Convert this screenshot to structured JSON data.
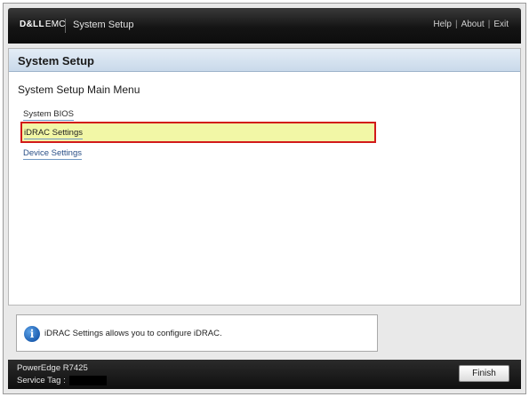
{
  "header": {
    "logo_dell": "D&LL",
    "logo_emc": "EMC",
    "title": "System Setup",
    "links": [
      "Help",
      "About",
      "Exit"
    ],
    "link_separator": "|"
  },
  "panel": {
    "title": "System Setup",
    "menu_heading": "System Setup Main Menu",
    "items": [
      {
        "label": "System BIOS",
        "selected": false
      },
      {
        "label": "iDRAC Settings",
        "selected": true
      },
      {
        "label": "Device Settings",
        "selected": false
      }
    ]
  },
  "info": {
    "icon": "info-icon",
    "glyph": "i",
    "text": "iDRAC Settings allows you to configure iDRAC."
  },
  "footer": {
    "model": "PowerEdge R7425",
    "service_tag_label": "Service Tag :",
    "finish_label": "Finish"
  },
  "colors": {
    "selection_fill": "#f2f7a6",
    "selection_border": "#d21a1a",
    "title_bar": "#c9d9ea",
    "header_bg": "#141414"
  }
}
